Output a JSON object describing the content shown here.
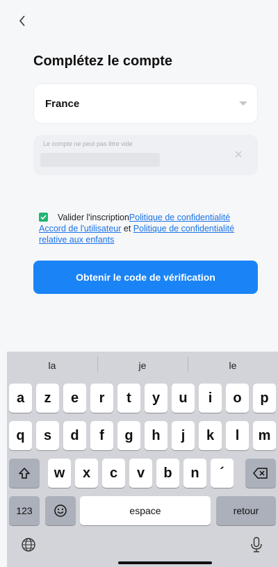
{
  "header": {
    "title": "Complétez le compte"
  },
  "form": {
    "country": "France",
    "account_error": "Le compte ne peut pas être vide",
    "account_value": ""
  },
  "consent": {
    "checked": true,
    "prefix": "Valider l'inscription",
    "link_privacy": "Politique de confidentialité",
    "link_user_agreement": "Accord de l'utilisateur",
    "conjunction": " et ",
    "link_children_privacy": "Politique de confidentialité relative aux enfants"
  },
  "cta": {
    "label": "Obtenir le code de vérification"
  },
  "keyboard": {
    "suggestions": [
      "la",
      "je",
      "le"
    ],
    "row1": [
      "a",
      "z",
      "e",
      "r",
      "t",
      "y",
      "u",
      "i",
      "o",
      "p"
    ],
    "row2": [
      "q",
      "s",
      "d",
      "f",
      "g",
      "h",
      "j",
      "k",
      "l",
      "m"
    ],
    "row3": [
      "w",
      "x",
      "c",
      "v",
      "b",
      "n",
      "´"
    ],
    "numbers_label": "123",
    "space_label": "espace",
    "return_label": "retour"
  },
  "colors": {
    "accent": "#1a84f6",
    "link": "#1a73e8",
    "checkbox": "#22b573"
  }
}
